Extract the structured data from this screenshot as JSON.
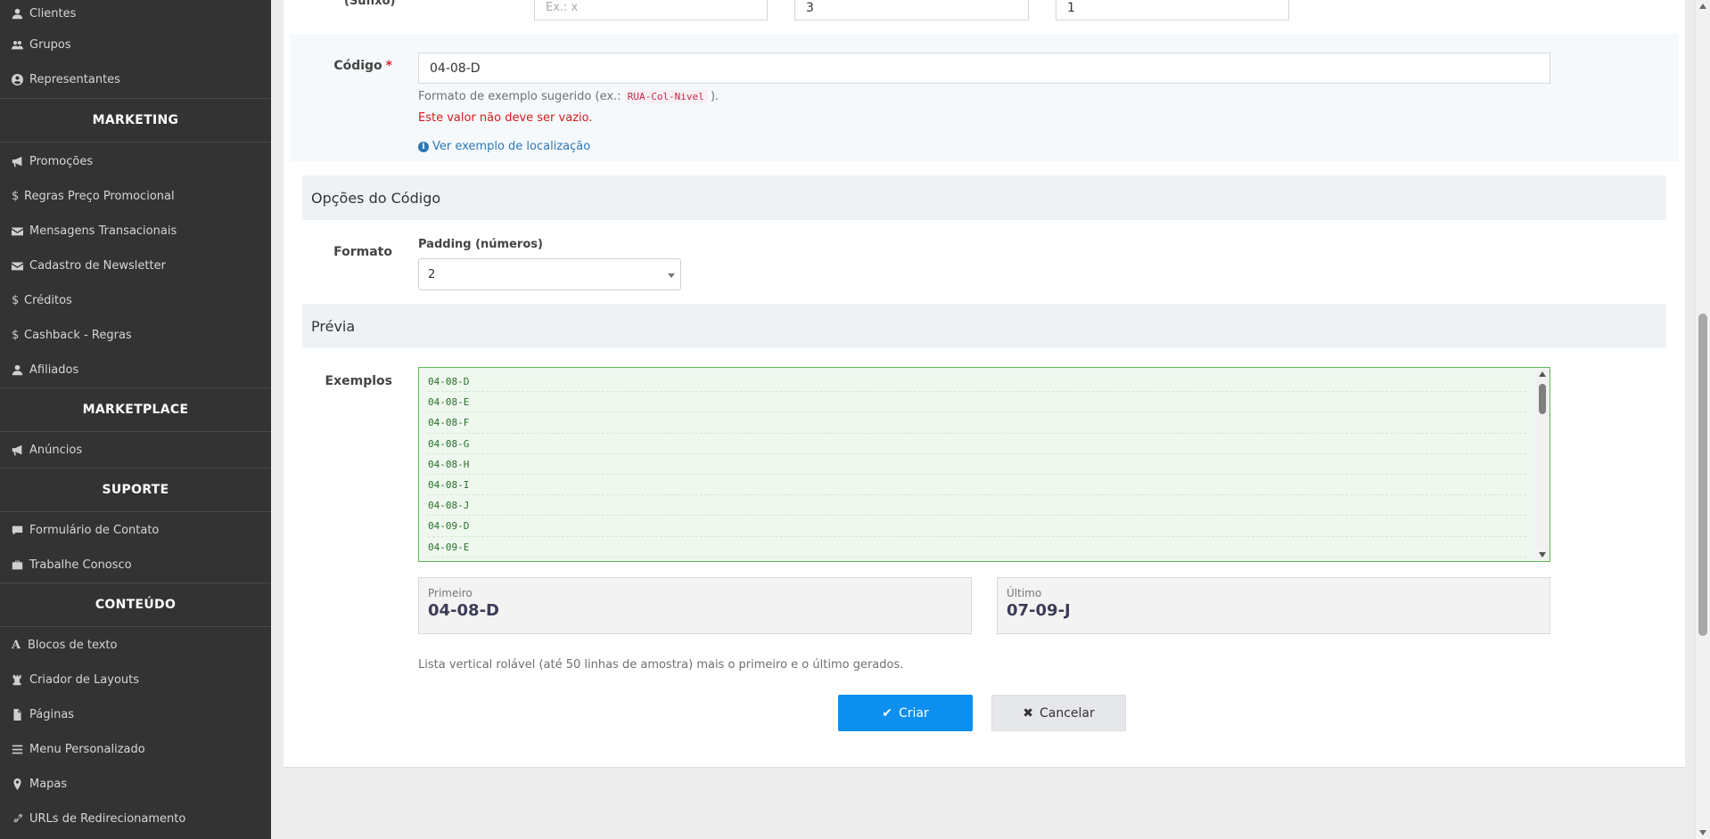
{
  "sidebar": {
    "items_top": [
      {
        "label": "Clientes",
        "icon": "user-icon"
      },
      {
        "label": "Grupos",
        "icon": "users-icon"
      },
      {
        "label": "Representantes",
        "icon": "user-circle-icon"
      }
    ],
    "marketing_title": "MARKETING",
    "marketing": [
      {
        "label": "Promoções",
        "icon": "bullhorn-icon"
      },
      {
        "label": "Regras Preço Promocional",
        "icon": "dollar-icon"
      },
      {
        "label": "Mensagens Transacionais",
        "icon": "envelope-icon"
      },
      {
        "label": "Cadastro de Newsletter",
        "icon": "envelope-icon"
      },
      {
        "label": "Créditos",
        "icon": "dollar-icon"
      },
      {
        "label": "Cashback - Regras",
        "icon": "dollar-icon"
      },
      {
        "label": "Afiliados",
        "icon": "user-icon"
      }
    ],
    "marketplace_title": "MARKETPLACE",
    "marketplace": [
      {
        "label": "Anúncios",
        "icon": "bullhorn-icon"
      }
    ],
    "suporte_title": "SUPORTE",
    "suporte": [
      {
        "label": "Formulário de Contato",
        "icon": "comment-icon"
      },
      {
        "label": "Trabalhe Conosco",
        "icon": "briefcase-icon"
      }
    ],
    "conteudo_title": "CONTEÚDO",
    "conteudo": [
      {
        "label": "Blocos de texto",
        "icon": "font-icon"
      },
      {
        "label": "Criador de Layouts",
        "icon": "chess-rook-icon"
      },
      {
        "label": "Páginas",
        "icon": "file-icon"
      },
      {
        "label": "Menu Personalizado",
        "icon": "bars-icon"
      },
      {
        "label": "Mapas",
        "icon": "map-marker-icon"
      },
      {
        "label": "URLs de Redirecionamento",
        "icon": "link-icon"
      }
    ]
  },
  "form": {
    "top_row": {
      "label": "(Sufixo)",
      "suffix_placeholder": "Ex.: x",
      "value_2": "3",
      "value_3": "1"
    },
    "codigo": {
      "label": "Código",
      "required_mark": "*",
      "value": "04-08-D",
      "help_prefix": "Formato de exemplo sugerido (ex.:",
      "help_code": "RUA-Col-Nivel",
      "help_suffix": ").",
      "error": "Este valor não deve ser vazio.",
      "link_icon": "i",
      "link": "Ver exemplo de localização"
    },
    "options_section": {
      "title": "Opções do Código",
      "format_label": "Formato",
      "padding_label": "Padding (números)",
      "padding_value": "2"
    },
    "preview_section": {
      "title": "Prévia",
      "examples_label": "Exemplos",
      "examples": [
        "04-08-D",
        "04-08-E",
        "04-08-F",
        "04-08-G",
        "04-08-H",
        "04-08-I",
        "04-08-J",
        "04-09-D",
        "04-09-E"
      ],
      "first_label": "Primeiro",
      "first_value": "04-08-D",
      "last_label": "Último",
      "last_value": "07-09-J",
      "note": "Lista vertical rolável (até 50 linhas de amostra) mais o primeiro e o último gerados."
    },
    "buttons": {
      "create_icon": "✔",
      "create": "Criar",
      "cancel_icon": "✖",
      "cancel": "Cancelar"
    }
  },
  "colors": {
    "sidebar_bg": "#333333",
    "primary": "#0d8fef",
    "error": "#d51b1b",
    "link": "#2d78b7",
    "success_border": "#5cb85c"
  }
}
